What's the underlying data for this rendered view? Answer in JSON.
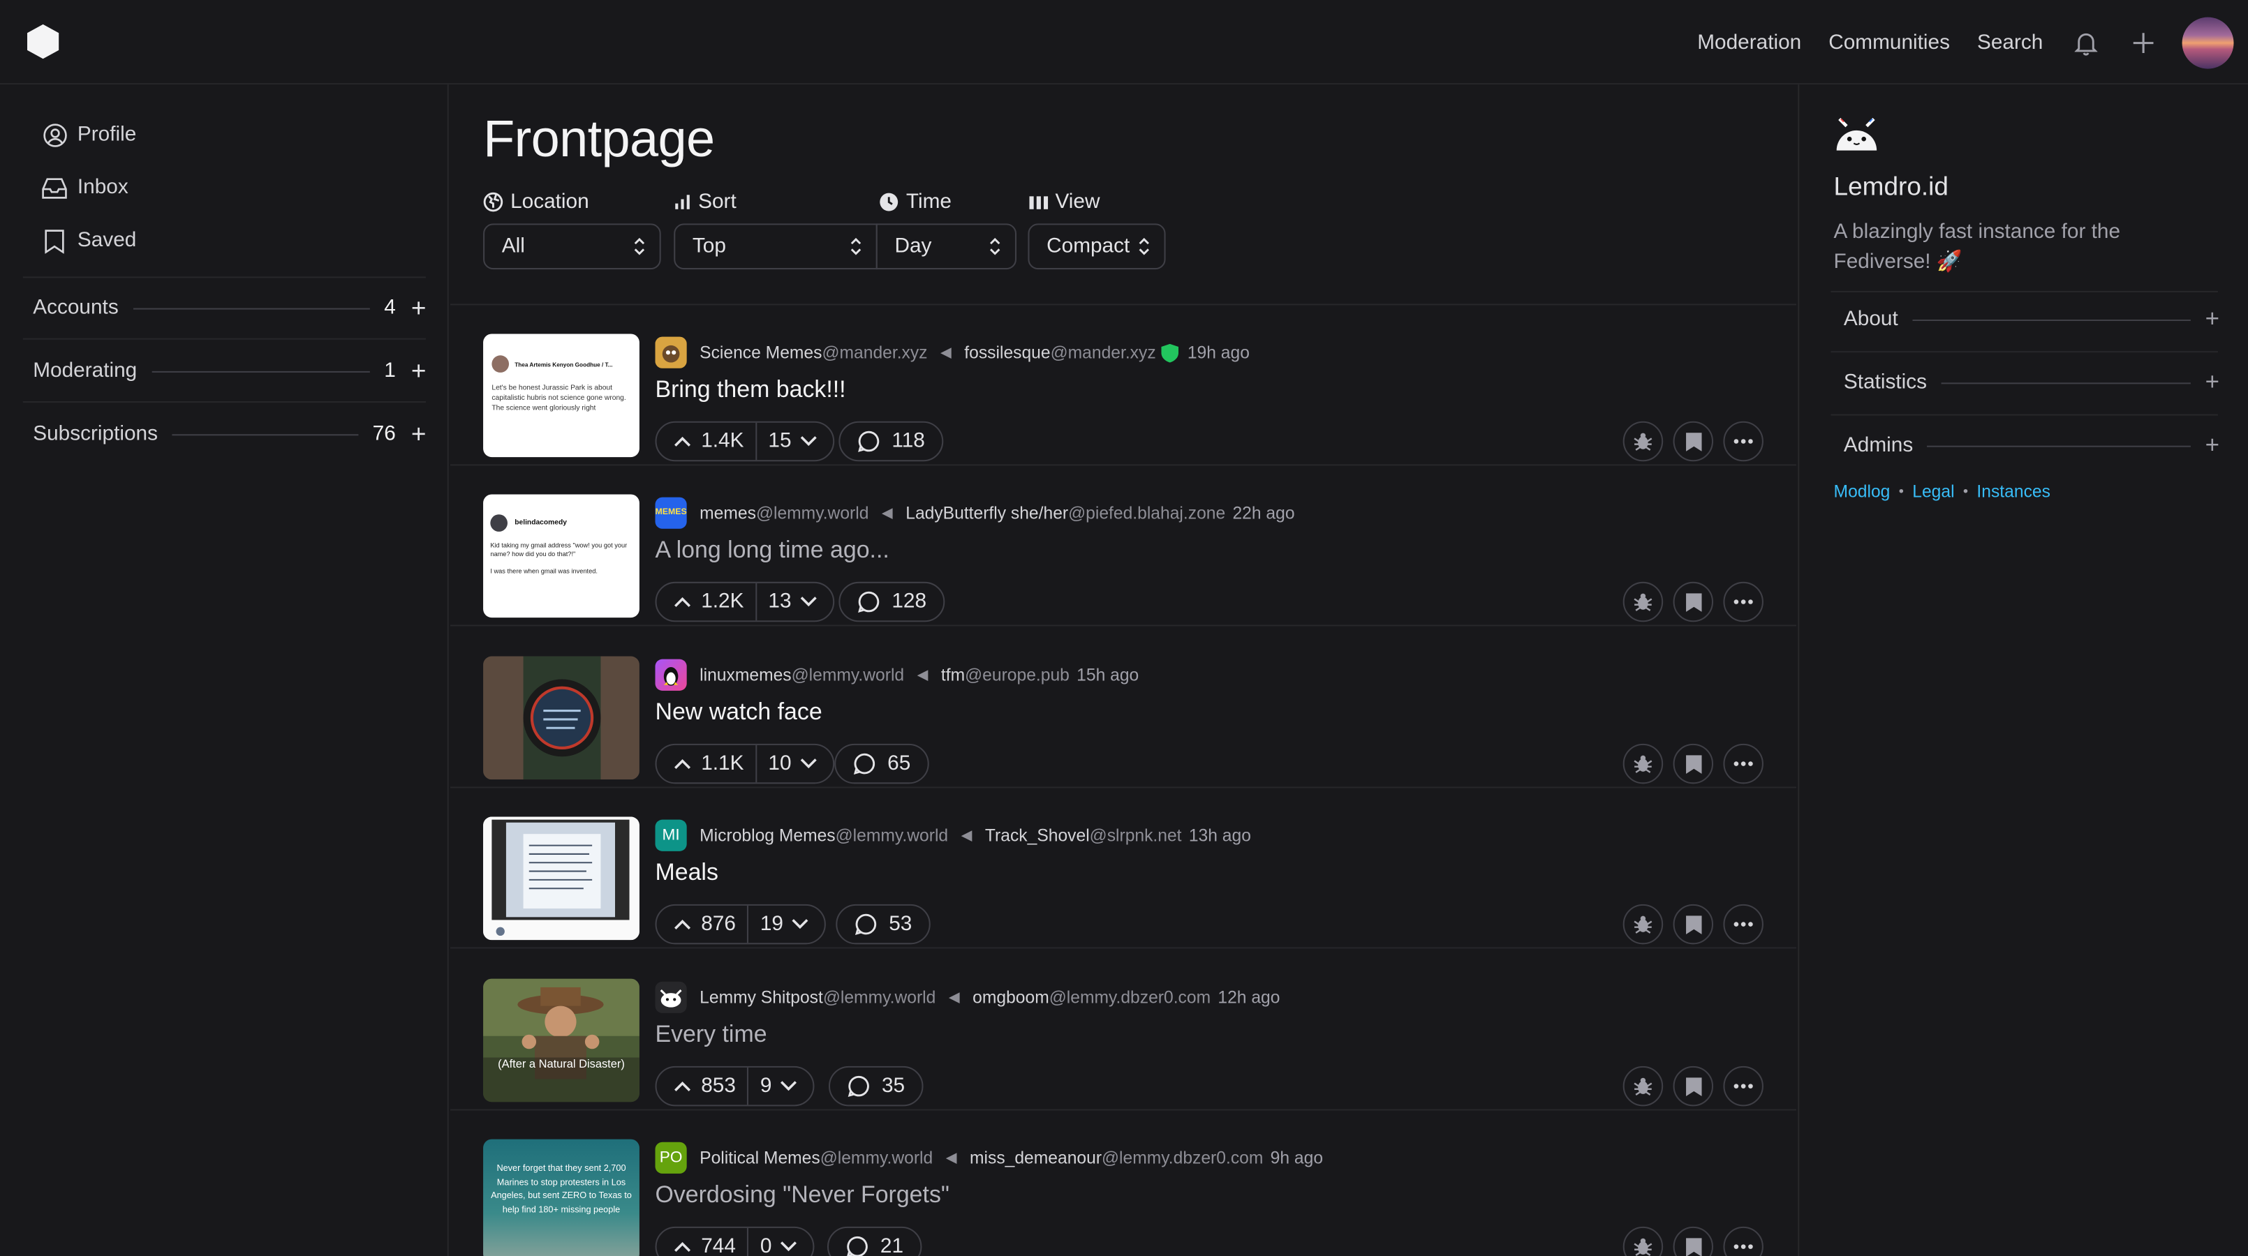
{
  "topnav": {
    "links": [
      "Moderation",
      "Communities",
      "Search"
    ]
  },
  "leftbar": {
    "items": [
      "Profile",
      "Inbox",
      "Saved"
    ],
    "groups": [
      {
        "label": "Accounts",
        "count": "4"
      },
      {
        "label": "Moderating",
        "count": "1"
      },
      {
        "label": "Subscriptions",
        "count": "76"
      }
    ]
  },
  "main": {
    "title": "Frontpage",
    "filters": {
      "location_label": "Location",
      "location_value": "All",
      "sort_label": "Sort",
      "sort_value": "Top",
      "time_label": "Time",
      "time_value": "Day",
      "view_label": "View",
      "view_value": "Compact"
    },
    "posts": [
      {
        "community": "Science Memes",
        "community_instance": "@mander.xyz",
        "author": "fossilesque",
        "author_instance": "@mander.xyz",
        "time": "19h ago",
        "title": "Bring them back!!!",
        "score": "1.4K",
        "downvotes": "15",
        "comments": "118"
      },
      {
        "community": "memes",
        "community_instance": "@lemmy.world",
        "author": "LadyButterfly she/her",
        "author_instance": "@piefed.blahaj.zone",
        "time": "22h ago",
        "title": "A long long time ago...",
        "score": "1.2K",
        "downvotes": "13",
        "comments": "128"
      },
      {
        "community": "linuxmemes",
        "community_instance": "@lemmy.world",
        "author": "tfm",
        "author_instance": "@europe.pub",
        "time": "15h ago",
        "title": "New watch face",
        "score": "1.1K",
        "downvotes": "10",
        "comments": "65"
      },
      {
        "community": "Microblog Memes",
        "community_instance": "@lemmy.world",
        "community_initials": "MI",
        "author": "Track_Shovel",
        "author_instance": "@slrpnk.net",
        "time": "13h ago",
        "title": "Meals",
        "score": "876",
        "downvotes": "19",
        "comments": "53"
      },
      {
        "community": "Lemmy Shitpost",
        "community_instance": "@lemmy.world",
        "author": "omgboom",
        "author_instance": "@lemmy.dbzer0.com",
        "time": "12h ago",
        "title": "Every time",
        "score": "853",
        "downvotes": "9",
        "comments": "35",
        "thumb_caption": "(After a Natural Disaster)"
      },
      {
        "community": "Political Memes",
        "community_instance": "@lemmy.world",
        "community_initials": "PO",
        "author": "miss_demeanour",
        "author_instance": "@lemmy.dbzer0.com",
        "time": "9h ago",
        "title": "Overdosing \"Never Forgets\"",
        "score": "744",
        "downvotes": "0",
        "comments": "21",
        "thumb_caption": "Never forget that they sent 2,700 Marines to stop protesters in Los Angeles, but sent ZERO to Texas to help find 180+ missing people"
      }
    ],
    "thumb1": {
      "name": "Thea Artemis Kenyon Goodhue / T...",
      "text": "Let's be honest Jurassic Park is about capitalistic hubris not science gone wrong. The science went gloriously right"
    },
    "thumb2": {
      "name": "belindacomedy",
      "text": "Kid taking my gmail address \"wow! you got your name? how did you do that?!\"",
      "text2": "I was there when gmail was invented."
    }
  },
  "rightbar": {
    "site_name": "Lemdro.id",
    "description": "A blazingly fast instance for the Fediverse! 🚀",
    "groups": [
      "About",
      "Statistics",
      "Admins"
    ],
    "footer": [
      "Modlog",
      "Legal",
      "Instances"
    ]
  },
  "colors": {
    "background": "#18181b",
    "border": "#27272a",
    "link": "#38bdf8",
    "mod_shield": "#22c55e"
  }
}
